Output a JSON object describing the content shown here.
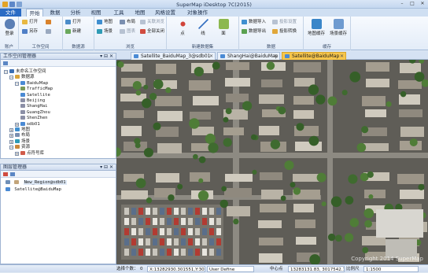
{
  "app": {
    "title": "SuperMap iDesktop 7C(2015)"
  },
  "tabs": [
    "文件",
    "开始",
    "数据",
    "分析",
    "视图",
    "工具",
    "地图",
    "风格设置",
    "对象操作"
  ],
  "ribbon": {
    "account": {
      "label": "登录",
      "group": "账户"
    },
    "workspace": {
      "open": "打开",
      "save_as": "另存",
      "group": "工作空间"
    },
    "datasource": {
      "open": "打开",
      "new": "新建",
      "group": "数据源"
    },
    "browse": {
      "map": "地图",
      "scene": "场景",
      "layout": "布局",
      "graph": "图表",
      "linkage": "关联浏览",
      "close_all": "全部关闭",
      "group": "浏览"
    },
    "dataset": {
      "point": "点",
      "line": "线",
      "region": "面",
      "group": "新建数据集"
    },
    "data": {
      "import": "数据导入",
      "export": "数据导出",
      "projection": "投影设置",
      "projection_convert": "投影转换",
      "group": "数据"
    },
    "cache": {
      "map_cache": "地图缓存",
      "scene_cache": "场景缓存",
      "group": "缓存"
    }
  },
  "workspace_panel": {
    "title": "工作空间管理器",
    "tree": [
      {
        "label": "未命名工作空间",
        "level": 0
      },
      {
        "label": "数据源",
        "level": 1
      },
      {
        "label": "BaiduMap",
        "level": 2
      },
      {
        "label": "TrafficMap",
        "level": 3
      },
      {
        "label": "Satellite",
        "level": 3
      },
      {
        "label": "Beijing",
        "level": 3
      },
      {
        "label": "ShangHai",
        "level": 3
      },
      {
        "label": "GuangZhou",
        "level": 3
      },
      {
        "label": "ShenZhen",
        "level": 3
      },
      {
        "label": "sdb01",
        "level": 2
      },
      {
        "label": "地图",
        "level": 1
      },
      {
        "label": "布局",
        "level": 1
      },
      {
        "label": "场景",
        "level": 1
      },
      {
        "label": "资源",
        "level": 1
      },
      {
        "label": "点符号库",
        "level": 2
      }
    ]
  },
  "layer_panel": {
    "title": "图层管理器",
    "layers": [
      "New_Region@sdb01",
      "Satellite@BaiduMap"
    ]
  },
  "map_tabs": [
    {
      "label": "Satellite_BaiduMap_3@sdb01",
      "active": false
    },
    {
      "label": "ShangHai@BaiduMap",
      "active": false
    },
    {
      "label": "Satellite@BaiduMap",
      "active": true
    }
  ],
  "map": {
    "watermark": "Copyright 2014 SuperMap"
  },
  "status": {
    "selected_label": "选择个数：",
    "selected_count": "0",
    "coords": "X:13282930.301551,Y:301762",
    "crs": "User Define",
    "center_label": "中心点",
    "center_value": "13283131.83, 3017542.714",
    "scale_label": "比例尺",
    "scale_value": "1:1500"
  },
  "colors": {
    "accent": "#2a6bc4",
    "active_tab": "#f7c64c",
    "panel_border": "#9fb4d2"
  }
}
